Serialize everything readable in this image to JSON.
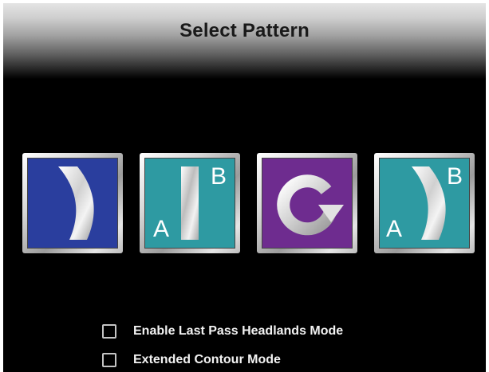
{
  "dialog": {
    "title": "Select Pattern"
  },
  "patterns": [
    {
      "name": "Contour",
      "icon": "curved-swath-icon",
      "bg": "#2a3e9e"
    },
    {
      "name": "Straight AB",
      "icon": "straight-ab-icon",
      "bg": "#2e9aa2",
      "label_a": "A",
      "label_b": "B"
    },
    {
      "name": "Pivot",
      "icon": "circular-arrow-icon",
      "bg": "#6e2c8f"
    },
    {
      "name": "Curved AB",
      "icon": "curved-ab-icon",
      "bg": "#2e9aa2",
      "label_a": "A",
      "label_b": "B"
    }
  ],
  "options": {
    "last_pass_headlands": {
      "label": "Enable Last Pass Headlands Mode",
      "checked": false
    },
    "extended_contour": {
      "label": "Extended Contour Mode",
      "checked": false
    }
  }
}
